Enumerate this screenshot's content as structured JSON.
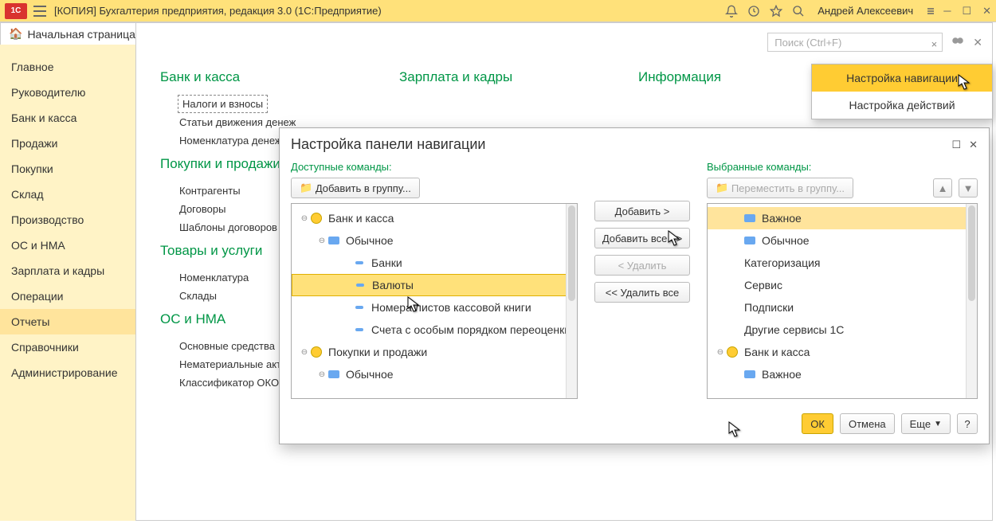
{
  "titlebar": {
    "logo": "1C",
    "title": "[КОПИЯ] Бухгалтерия предприятия, редакция 3.0  (1С:Предприятие)",
    "user": "Андрей Алексеевич"
  },
  "home_tab": "Начальная страница",
  "sidebar": [
    {
      "label": "Главное",
      "active": false
    },
    {
      "label": "Руководителю",
      "active": false
    },
    {
      "label": "Банк и касса",
      "active": false
    },
    {
      "label": "Продажи",
      "active": false
    },
    {
      "label": "Покупки",
      "active": false
    },
    {
      "label": "Склад",
      "active": false
    },
    {
      "label": "Производство",
      "active": false
    },
    {
      "label": "ОС и НМА",
      "active": false
    },
    {
      "label": "Зарплата и кадры",
      "active": false
    },
    {
      "label": "Операции",
      "active": false
    },
    {
      "label": "Отчеты",
      "active": true
    },
    {
      "label": "Справочники",
      "active": false
    },
    {
      "label": "Администрирование",
      "active": false
    }
  ],
  "search_placeholder": "Поиск (Ctrl+F)",
  "content_columns": [
    {
      "heading": "Банк и касса",
      "links": [
        {
          "label": "Налоги и взносы",
          "boxed": true
        },
        {
          "label": "Статьи движения денеж"
        },
        {
          "label": "Номенклатура денежны"
        }
      ]
    },
    {
      "heading": "Покупки и продажи",
      "links": [
        {
          "label": "Контрагенты"
        },
        {
          "label": "Договоры"
        },
        {
          "label": "Шаблоны договоров"
        }
      ]
    },
    {
      "heading": "Товары и услуги",
      "links": [
        {
          "label": "Номенклатура"
        },
        {
          "label": "Склады"
        }
      ]
    },
    {
      "heading": "ОС и НМА",
      "links": [
        {
          "label": "Основные средства"
        },
        {
          "label": "Нематериальные актив"
        },
        {
          "label": "Классификатор ОКОФ"
        }
      ]
    }
  ],
  "col2_heading": "Зарплата и кадры",
  "col3_heading": "Информация",
  "gear_menu": {
    "item1": "Настройка навигации",
    "item2": "Настройка действий"
  },
  "modal": {
    "title": "Настройка панели навигации",
    "left_label": "Доступные команды:",
    "right_label": "Выбранные команды:",
    "add_group_btn": "Добавить в группу...",
    "move_group_btn": "Переместить в группу...",
    "mid": {
      "add": "Добавить >",
      "add_all": "Добавить все >>",
      "remove": "< Удалить",
      "remove_all": "<< Удалить все"
    },
    "left_tree": [
      {
        "type": "folder",
        "label": "Банк и касса",
        "depth": 0,
        "expand": "minus"
      },
      {
        "type": "group",
        "label": "Обычное",
        "depth": 1,
        "expand": "minus"
      },
      {
        "type": "item",
        "label": "Банки",
        "depth": 2
      },
      {
        "type": "item",
        "label": "Валюты",
        "depth": 2,
        "selected": true
      },
      {
        "type": "item",
        "label": "Номера листов кассовой книги",
        "depth": 2
      },
      {
        "type": "item",
        "label": "Счета с особым порядком переоценки",
        "depth": 2
      },
      {
        "type": "folder",
        "label": "Покупки и продажи",
        "depth": 0,
        "expand": "minus"
      },
      {
        "type": "group",
        "label": "Обычное",
        "depth": 1,
        "expand": "minus"
      }
    ],
    "right_tree": [
      {
        "type": "group",
        "label": "Важное",
        "depth": 1,
        "selected": true
      },
      {
        "type": "group",
        "label": "Обычное",
        "depth": 1
      },
      {
        "type": "plain",
        "label": "Категоризация",
        "depth": 1
      },
      {
        "type": "plain",
        "label": "Сервис",
        "depth": 1
      },
      {
        "type": "plain",
        "label": "Подписки",
        "depth": 1
      },
      {
        "type": "plain",
        "label": "Другие сервисы 1С",
        "depth": 1
      },
      {
        "type": "folder",
        "label": "Банк и касса",
        "depth": 0,
        "expand": "minus"
      },
      {
        "type": "group",
        "label": "Важное",
        "depth": 1
      }
    ],
    "footer": {
      "ok": "ОК",
      "cancel": "Отмена",
      "more": "Еще",
      "help": "?"
    }
  }
}
